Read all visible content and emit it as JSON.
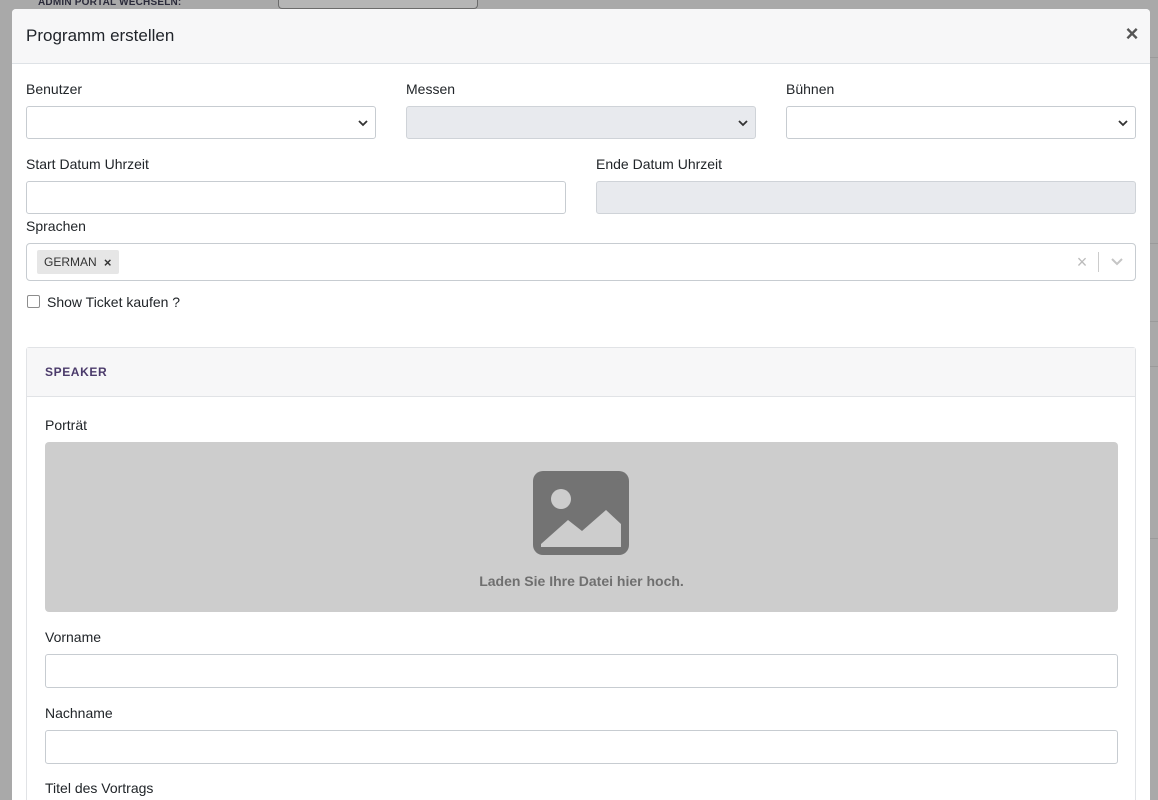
{
  "background": {
    "admin_label": "ADMIN PORTAL WECHSELN:"
  },
  "modal": {
    "title": "Programm erstellen",
    "close_glyph": "×"
  },
  "form": {
    "benutzer_label": "Benutzer",
    "messen_label": "Messen",
    "buehnen_label": "Bühnen",
    "start_label": "Start Datum Uhrzeit",
    "end_label": "Ende Datum Uhrzeit",
    "sprachen_label": "Sprachen",
    "sprachen_tags": [
      "GERMAN"
    ],
    "tag_remove_glyph": "×",
    "clear_glyph": "×",
    "show_ticket_label": "Show Ticket kaufen ?",
    "show_ticket_checked": false
  },
  "speaker": {
    "title": "SPEAKER",
    "portrait_label": "Porträt",
    "upload_text": "Laden Sie Ihre Datei hier hoch.",
    "vorname_label": "Vorname",
    "nachname_label": "Nachname",
    "titel_label": "Titel des Vortrags"
  },
  "icons": {
    "close": "close-icon",
    "chevron": "chevron-down-icon",
    "image": "image-placeholder-icon"
  },
  "colors": {
    "speaker_title": "#4b3b6b",
    "dropzone": "#cdcdcd",
    "disabled_field": "#e8eaee"
  }
}
